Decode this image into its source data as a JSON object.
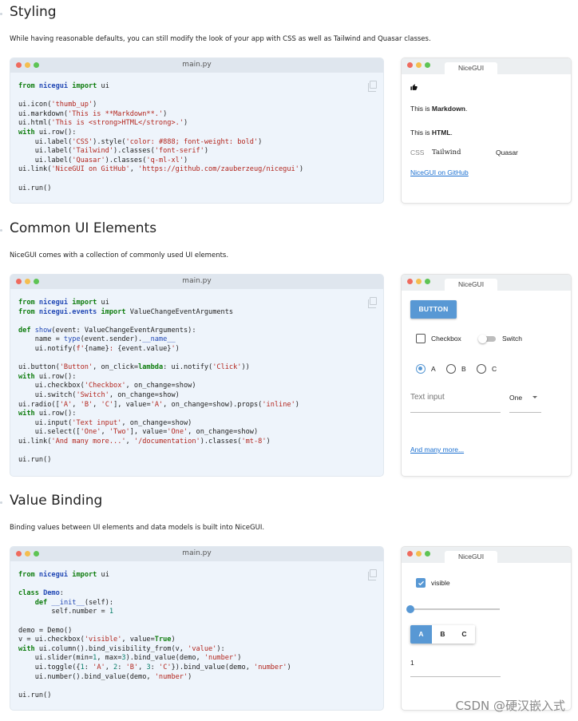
{
  "sections": [
    {
      "title": "Styling",
      "description": "While having reasonable defaults, you can still modify the look of your app with CSS as well as Tailwind and Quasar classes.",
      "filename": "main.py",
      "demo_tab": "NiceGUI",
      "demo": {
        "markdown_prefix": "This is ",
        "markdown_bold": "Markdown",
        "html_prefix": "This is ",
        "html_bold": "HTML",
        "label_css": "CSS",
        "label_tailwind": "Tailwind",
        "label_quasar": "Quasar",
        "link": "NiceGUI on GitHub"
      }
    },
    {
      "title": "Common UI Elements",
      "description": "NiceGUI comes with a collection of commonly used UI elements.",
      "filename": "main.py",
      "demo_tab": "NiceGUI",
      "demo": {
        "button": "BUTTON",
        "checkbox": "Checkbox",
        "switch": "Switch",
        "radio_a": "A",
        "radio_b": "B",
        "radio_c": "C",
        "input_placeholder": "Text input",
        "select_value": "One",
        "link": "And many more..."
      }
    },
    {
      "title": "Value Binding",
      "description": "Binding values between UI elements and data models is built into NiceGUI.",
      "filename": "main.py",
      "demo_tab": "NiceGUI",
      "demo": {
        "checkbox": "visible",
        "toggle_a": "A",
        "toggle_b": "B",
        "toggle_c": "C",
        "number_value": "1"
      }
    }
  ],
  "watermark": "CSDN @硬汉嵌入式",
  "colors": {
    "accent": "#5898d4",
    "code_bg": "#eef4fb",
    "link": "#1a6fd0"
  }
}
